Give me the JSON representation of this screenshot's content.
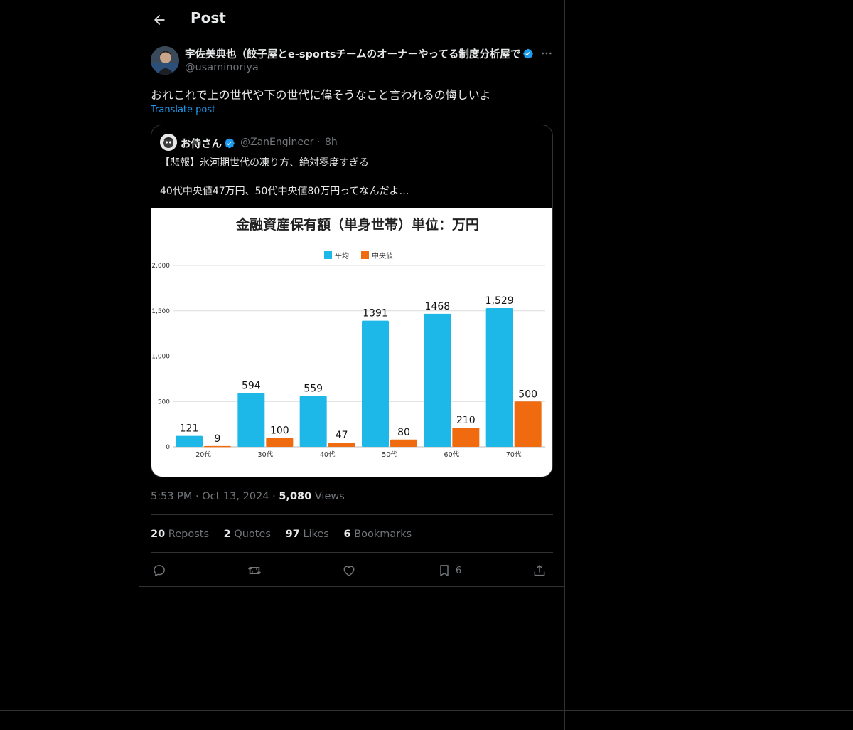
{
  "header": {
    "title": "Post"
  },
  "author": {
    "name": "宇佐美典也（餃子屋とe-sportsチームのオーナーやってる制度分析屋で",
    "handle": "@usaminoriya"
  },
  "post": {
    "text": "おれこれで上の世代や下の世代に偉そうなこと言われるの悔しいよ",
    "translate_label": "Translate post"
  },
  "quote": {
    "name": "お侍さん",
    "handle": "@ZanEngineer",
    "dot": "·",
    "time": "8h",
    "line1": "【悲報】氷河期世代の凍り方、絶対零度すぎる",
    "line2": "40代中央値47万円、50代中央値80万円ってなんだよ…"
  },
  "chart_data": {
    "type": "bar",
    "title": "金融資産保有額（単身世帯）単位：万円",
    "categories": [
      "20代",
      "30代",
      "40代",
      "50代",
      "60代",
      "70代"
    ],
    "series": [
      {
        "name": "平均",
        "values": [
          121,
          594,
          559,
          1391,
          1468,
          1529
        ],
        "color": "#1eb8e8"
      },
      {
        "name": "中央値",
        "values": [
          9,
          100,
          47,
          80,
          210,
          500
        ],
        "color": "#f06a0f"
      }
    ],
    "value_labels": {
      "平均": [
        "121",
        "594",
        "559",
        "1391",
        "1468",
        "1,529"
      ],
      "中央値": [
        "9",
        "100",
        "47",
        "80",
        "210",
        "500"
      ]
    },
    "y_ticks": [
      "0",
      "500",
      "1,000",
      "1,500",
      "2,000"
    ],
    "ylim": [
      0,
      2000
    ],
    "grid": true,
    "legend": "top-center"
  },
  "meta": {
    "time": "5:53 PM",
    "sep1": "·",
    "date": "Oct 13, 2024",
    "sep2": "·",
    "views_count": "5,080",
    "views_label": "Views"
  },
  "stats": {
    "reposts_count": "20",
    "reposts_label": "Reposts",
    "quotes_count": "2",
    "quotes_label": "Quotes",
    "likes_count": "97",
    "likes_label": "Likes",
    "bookmarks_count": "6",
    "bookmarks_label": "Bookmarks"
  },
  "actions": {
    "bookmark_count": "6"
  },
  "colors": {
    "accent": "#1d9bf0",
    "text": "#e7e9ea",
    "muted": "#71767b",
    "border": "#2f3336"
  }
}
